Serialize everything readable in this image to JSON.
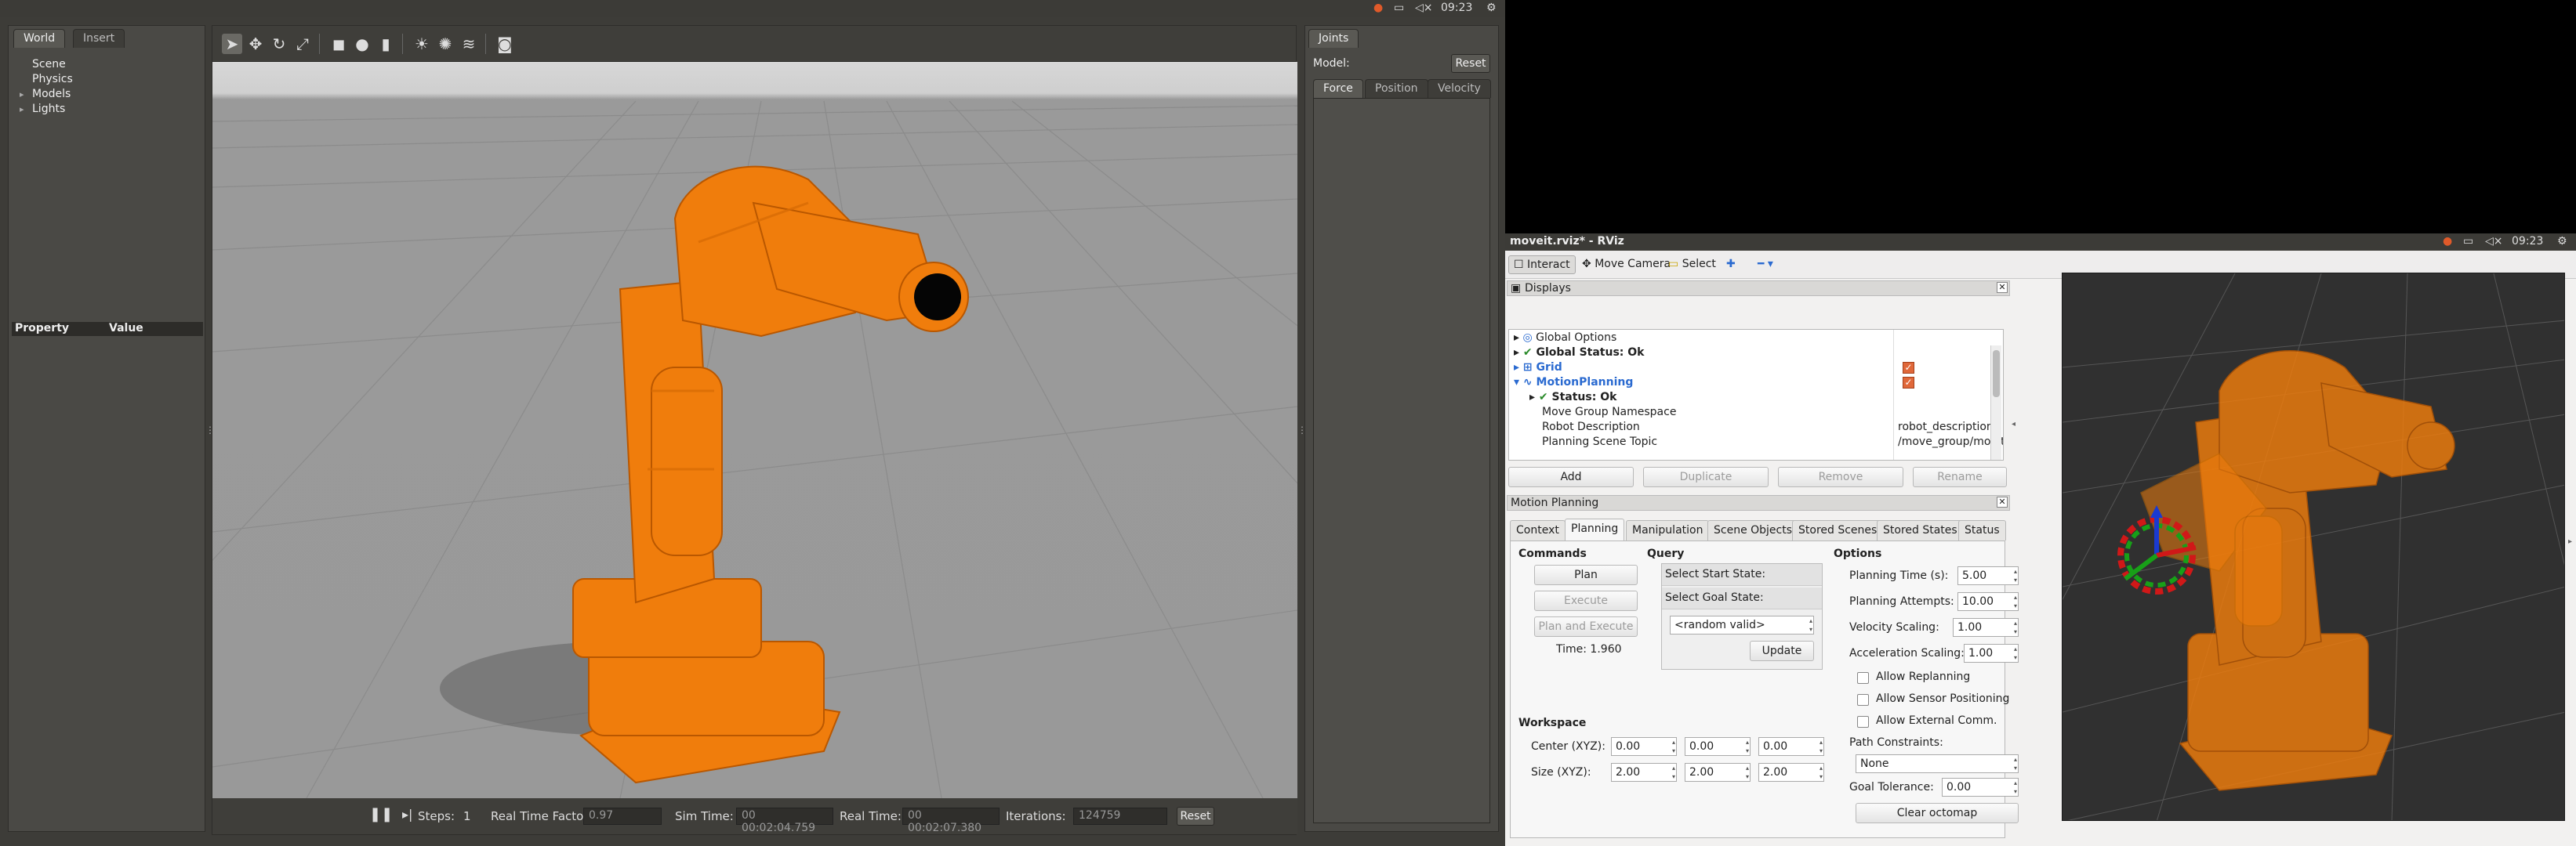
{
  "topbar": {
    "time": "09:23"
  },
  "gazebo": {
    "left_tabs": [
      "World",
      "Insert"
    ],
    "tree": [
      {
        "label": "Scene",
        "expandable": false
      },
      {
        "label": "Physics",
        "expandable": false
      },
      {
        "label": "Models",
        "expandable": true
      },
      {
        "label": "Lights",
        "expandable": true
      }
    ],
    "property_header": {
      "property": "Property",
      "value": "Value"
    },
    "toolbar_icons": [
      "select-arrow-icon",
      "translate-icon",
      "rotate-icon",
      "scale-icon",
      "box-icon",
      "sphere-icon",
      "cylinder-icon",
      "point-light-icon",
      "spot-light-icon",
      "directional-light-icon",
      "screenshot-icon"
    ],
    "bottom": {
      "steps_label": "Steps:",
      "steps_value": "1",
      "rtf_label": "Real Time Factor:",
      "rtf_value": "0.97",
      "simtime_label": "Sim Time:",
      "simtime_value": "00 00:02:04.759",
      "realtime_label": "Real Time:",
      "realtime_value": "00 00:02:07.380",
      "iterations_label": "Iterations:",
      "iterations_value": "124759",
      "reset_label": "Reset"
    },
    "joints": {
      "tab": "Joints",
      "model_label": "Model:",
      "reset_label": "Reset",
      "subtabs": [
        "Force",
        "Position",
        "Velocity"
      ]
    }
  },
  "rviz": {
    "title": "moveit.rviz* - RViz",
    "time": "09:23",
    "toolbar": {
      "interact": "Interact",
      "move_camera": "Move Camera",
      "select": "Select"
    },
    "displays": {
      "title": "Displays",
      "rows": [
        {
          "label": "Global Options",
          "value": ""
        },
        {
          "label": "Global Status: Ok",
          "value": ""
        },
        {
          "label": "Grid",
          "value": ""
        },
        {
          "label": "MotionPlanning",
          "value": ""
        },
        {
          "label": "Status: Ok",
          "value": ""
        },
        {
          "label": "Move Group Namespace",
          "value": ""
        },
        {
          "label": "Robot Description",
          "value": "robot_description"
        },
        {
          "label": "Planning Scene Topic",
          "value": "/move_group/monitor..."
        }
      ],
      "buttons": [
        "Add",
        "Duplicate",
        "Remove",
        "Rename"
      ]
    },
    "motion_planning": {
      "title": "Motion Planning",
      "tabs": [
        "Context",
        "Planning",
        "Manipulation",
        "Scene Objects",
        "Stored Scenes",
        "Stored States",
        "Status"
      ],
      "commands": {
        "title": "Commands",
        "plan": "Plan",
        "execute": "Execute",
        "plan_execute": "Plan and Execute",
        "time": "Time: 1.960"
      },
      "query": {
        "title": "Query",
        "start": "Select Start State:",
        "goal": "Select Goal State:",
        "goal_value": "<random valid>",
        "update": "Update"
      },
      "options": {
        "title": "Options",
        "planning_time_label": "Planning Time (s):",
        "planning_time": "5.00",
        "attempts_label": "Planning Attempts:",
        "attempts": "10.00",
        "velocity_label": "Velocity Scaling:",
        "velocity": "1.00",
        "accel_label": "Acceleration Scaling:",
        "accel": "1.00",
        "replanning": "Allow Replanning",
        "sensor": "Allow Sensor Positioning",
        "external": "Allow External Comm.",
        "constraints_label": "Path Constraints:",
        "constraints": "None",
        "goal_tol_label": "Goal Tolerance:",
        "goal_tol": "0.00",
        "clear_octomap": "Clear octomap"
      },
      "workspace": {
        "title": "Workspace",
        "center_label": "Center (XYZ):",
        "center": [
          "0.00",
          "0.00",
          "0.00"
        ],
        "size_label": "Size (XYZ):",
        "size": [
          "2.00",
          "2.00",
          "2.00"
        ]
      }
    }
  }
}
